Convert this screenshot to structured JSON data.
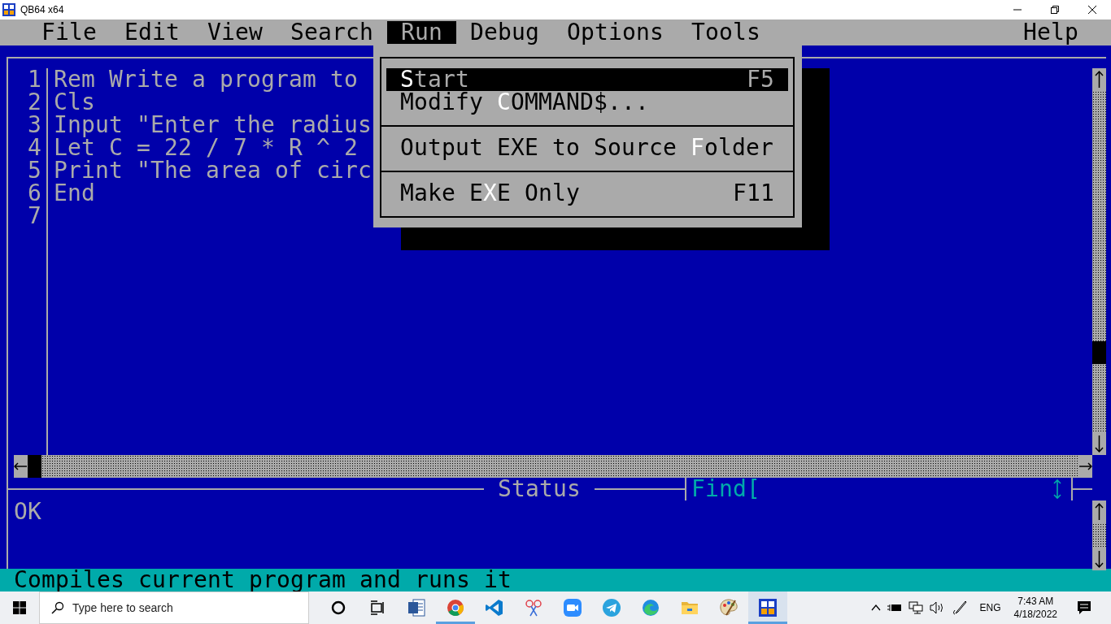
{
  "window": {
    "title": "QB64 x64"
  },
  "menu_bar": [
    {
      "label": "File",
      "selected": false
    },
    {
      "label": "Edit",
      "selected": false
    },
    {
      "label": "View",
      "selected": false
    },
    {
      "label": "Search",
      "selected": false
    },
    {
      "label": "Run",
      "selected": true
    },
    {
      "label": "Debug",
      "selected": false
    },
    {
      "label": "Options",
      "selected": false
    },
    {
      "label": "Tools",
      "selected": false
    },
    {
      "label": "Help",
      "selected": false
    }
  ],
  "run_menu": {
    "groups": [
      [
        {
          "hotkey": "S",
          "after": "tart",
          "shortcut": "F5",
          "selected": true
        },
        {
          "before": "Modify ",
          "hotkey": "C",
          "after": "OMMAND$...",
          "selected": false
        }
      ],
      [
        {
          "before": "Output EXE to Source ",
          "hotkey": "F",
          "after": "older",
          "selected": false
        }
      ],
      [
        {
          "before": "Make E",
          "hotkey": "X",
          "after": "E Only",
          "shortcut": "F11",
          "selected": false
        }
      ]
    ]
  },
  "editor": {
    "lines": [
      {
        "number": "1",
        "code": "Rem Write a program to"
      },
      {
        "number": "2",
        "code": "Cls"
      },
      {
        "number": "3",
        "code": "Input \"Enter the radius"
      },
      {
        "number": "4",
        "code": "Let C = 22 / 7 * R ^ 2"
      },
      {
        "number": "5",
        "code": "Print \"The area of circ"
      },
      {
        "number": "6",
        "code": "End"
      },
      {
        "number": "7"
      }
    ]
  },
  "status_panel": {
    "title": "Status",
    "find_label": "Find[",
    "message": "OK"
  },
  "status_bar": "Compiles current program and runs it",
  "taskbar": {
    "search_placeholder": "Type here to search",
    "apps": [
      {
        "kind": "cortana",
        "running": false,
        "selected": false
      },
      {
        "kind": "taskview",
        "running": false,
        "selected": false
      },
      {
        "kind": "word",
        "running": false,
        "selected": false
      },
      {
        "kind": "chrome",
        "running": true,
        "selected": false
      },
      {
        "kind": "vscode",
        "running": false,
        "selected": false
      },
      {
        "kind": "snip",
        "running": false,
        "selected": false
      },
      {
        "kind": "zoom",
        "running": false,
        "selected": false
      },
      {
        "kind": "telegram",
        "running": false,
        "selected": false
      },
      {
        "kind": "edge",
        "running": false,
        "selected": false
      },
      {
        "kind": "folder",
        "running": false,
        "selected": false
      },
      {
        "kind": "paint",
        "running": false,
        "selected": false
      },
      {
        "kind": "qb64",
        "running": true,
        "selected": true
      }
    ],
    "language": "ENG",
    "time": "7:43 AM",
    "date": "4/18/2022"
  }
}
